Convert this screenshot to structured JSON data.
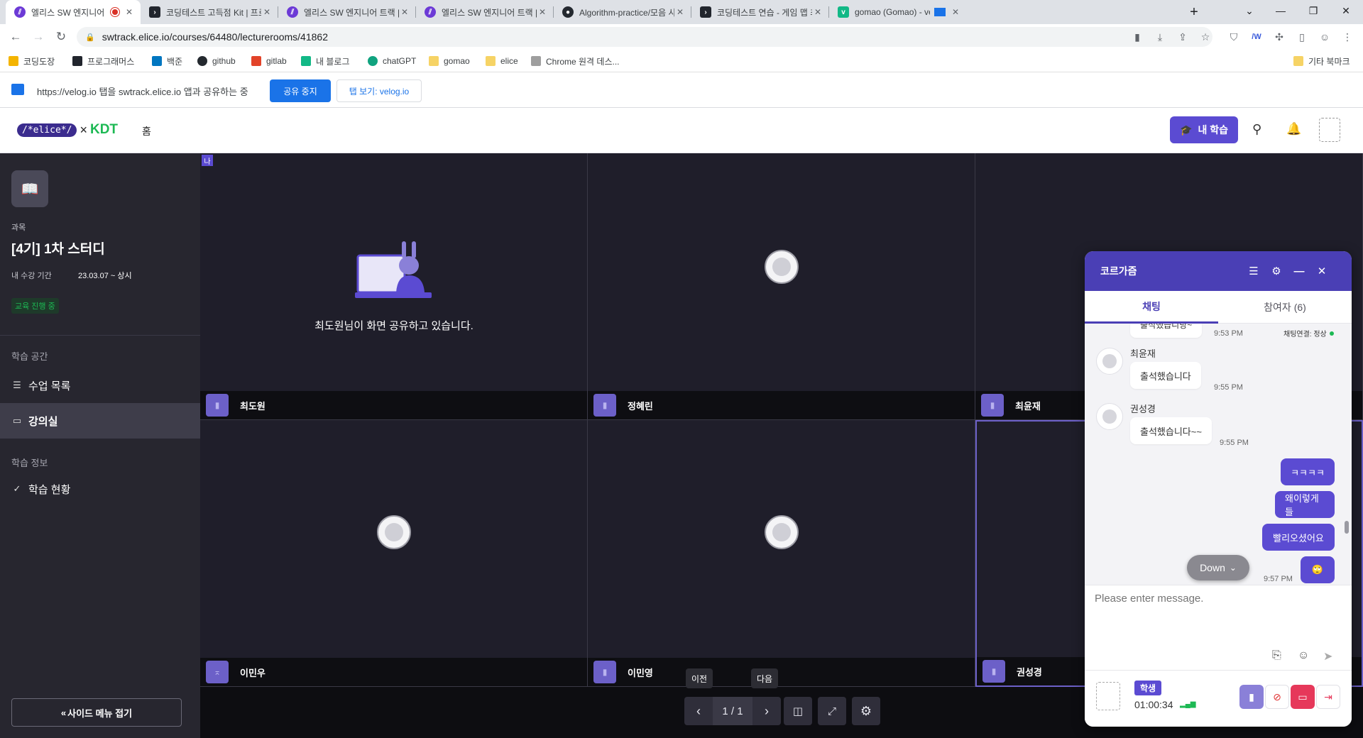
{
  "browser": {
    "tabs": [
      {
        "title": "엘리스 SW 엔지니어 트랙 |",
        "favicon": "elice-icon",
        "active": true
      },
      {
        "title": "코딩테스트 고득점 Kit | 프로그래",
        "favicon": "programmers-icon"
      },
      {
        "title": "엘리스 SW 엔지니어 트랙 | K-d",
        "favicon": "elice-icon"
      },
      {
        "title": "엘리스 SW 엔지니어 트랙 | K-d",
        "favicon": "elice-icon"
      },
      {
        "title": "Algorithm-practice/모음 사전.p",
        "favicon": "github-icon"
      },
      {
        "title": "코딩테스트 연습 - 게임 맵 최단",
        "favicon": "programmers-icon"
      },
      {
        "title": "gomao (Gomao) - velog",
        "favicon": "velog-icon"
      }
    ],
    "new_tab": "+",
    "url": "swtrack.elice.io/courses/64480/lecturerooms/41862",
    "bookmarks": [
      {
        "label": "코딩도장",
        "color": "#f4b400"
      },
      {
        "label": "프로그래머스",
        "color": "#21252d"
      },
      {
        "label": "백준",
        "color": "#0076c0"
      },
      {
        "label": "github",
        "color": "#24292f"
      },
      {
        "label": "gitlab",
        "color": "#e24329"
      },
      {
        "label": "내 블로그",
        "color": "#12b886"
      },
      {
        "label": "chatGPT",
        "color": "#10a37f"
      },
      {
        "label": "gomao",
        "color": "#f6d365"
      },
      {
        "label": "elice",
        "color": "#f6d365"
      },
      {
        "label": "Chrome 원격 데스...",
        "color": "#9e9e9e"
      }
    ],
    "other_bookmarks": "기타 북마크"
  },
  "share_bar": {
    "message": "https://velog.io 탭을 swtrack.elice.io 앱과 공유하는 중",
    "stop_label": "공유 중지",
    "view_label": "탭 보기: velog.io"
  },
  "header": {
    "logo_text": "/*elice*/",
    "logo_x": "×",
    "logo_kdt": "KDT",
    "home": "홈",
    "my_learning": "내 학습"
  },
  "sidebar": {
    "course_label": "과목",
    "course_title": "[4기] 1차 스터디",
    "period_label": "내 수강 기간",
    "period_value": "23.03.07 ~ 상시",
    "status_badge": "교육 진행 중",
    "section_space": "학습 공간",
    "item_classes": "수업 목록",
    "item_lectureroom": "강의실",
    "section_info": "학습 정보",
    "item_progress": "학습 현황",
    "collapse": "사이드 메뉴 접기"
  },
  "grid": {
    "me_badge": "나",
    "share_message": "최도원님이 화면 공유하고 있습니다.",
    "participants": [
      "최도원",
      "정혜린",
      "최윤재",
      "이민우",
      "이민영",
      "권성경"
    ]
  },
  "controls": {
    "prev_tooltip": "이전",
    "next_tooltip": "다음",
    "page": "1 / 1"
  },
  "chat": {
    "title": "코르가즘",
    "tab_chat": "채팅",
    "tab_participants": "참여자 (6)",
    "connection": "채팅연결: 정상",
    "partial_bubble": "출석했습니당~",
    "partial_time": "9:53 PM",
    "messages": [
      {
        "sender": "최윤재",
        "text": "출석했습니다",
        "time": "9:55 PM"
      },
      {
        "sender": "권성경",
        "text": "출석했습니다~~",
        "time": "9:55 PM"
      }
    ],
    "my_messages": [
      "ㅋㅋㅋㅋ",
      "왜이렇게들",
      "빨리오셨어요",
      "🙄"
    ],
    "my_time": "9:57 PM",
    "down_label": "Down",
    "input_placeholder": "Please enter message.",
    "role_badge": "학생",
    "elapsed": "01:00:34"
  },
  "colors": {
    "brand": "#5b4bd2",
    "chat_header": "#4a3fb5",
    "status_green": "#1db954",
    "sidebar_bg": "#27262f",
    "grid_bg": "#1f1e2a"
  }
}
